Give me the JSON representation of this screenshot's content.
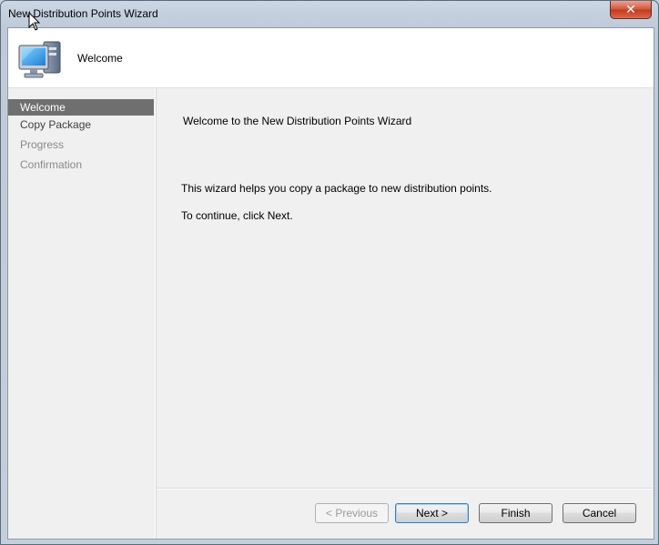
{
  "window": {
    "title": "New Distribution Points Wizard",
    "close_label": "✕"
  },
  "header": {
    "title": "Welcome",
    "icon": "computer-icon"
  },
  "sidebar": {
    "items": [
      {
        "label": "Welcome",
        "state": "active"
      },
      {
        "label": "Copy Package",
        "state": "enabled"
      },
      {
        "label": "Progress",
        "state": "dimmed"
      },
      {
        "label": "Confirmation",
        "state": "dimmed"
      }
    ]
  },
  "main": {
    "heading": "Welcome to the New Distribution Points Wizard",
    "description": "This wizard helps you copy a package to new distribution points.",
    "instruction": "To continue, click Next."
  },
  "buttons": {
    "previous": "< Previous",
    "next": "Next >",
    "finish": "Finish",
    "cancel": "Cancel"
  },
  "colors": {
    "active_item_bg": "#6f6f6f",
    "close_button": "#c43a1f",
    "default_button_border": "#3c7fb1"
  }
}
